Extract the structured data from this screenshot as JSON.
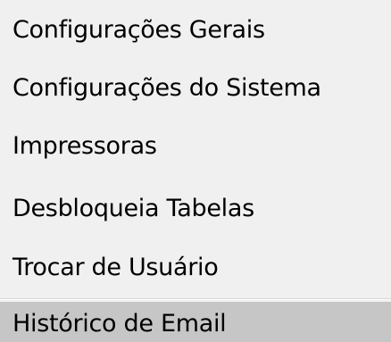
{
  "menu": {
    "items": [
      {
        "label": "Configurações Gerais"
      },
      {
        "label": "Configurações do Sistema"
      },
      {
        "label": "Impressoras"
      },
      {
        "label": "Desbloqueia Tabelas"
      },
      {
        "label": "Trocar de Usuário"
      },
      {
        "label": "Histórico de Email"
      }
    ],
    "highlighted_index": 5
  },
  "colors": {
    "menu_background": "#f0f0f0",
    "highlight_background": "#c6c6c6",
    "text": "#000000"
  }
}
